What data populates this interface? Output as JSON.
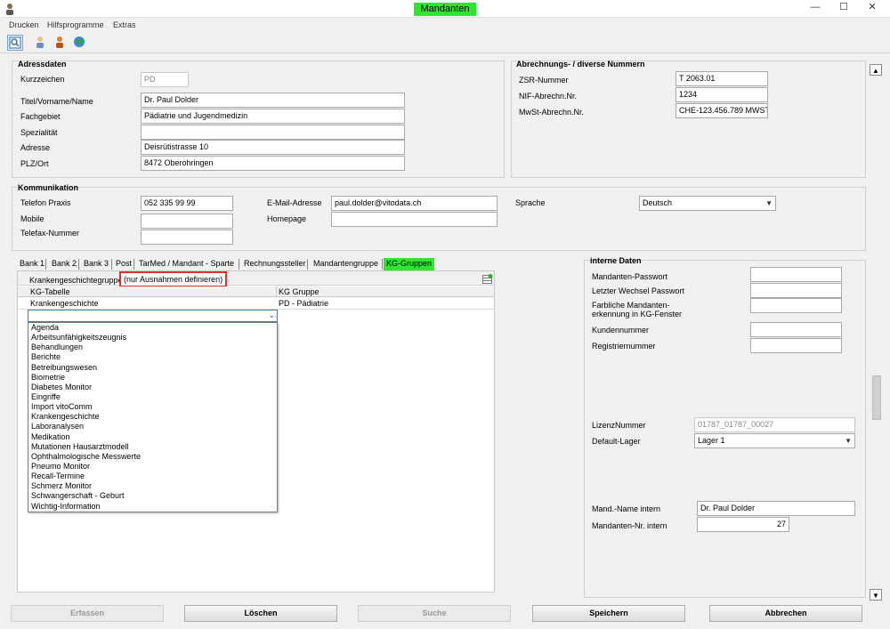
{
  "window": {
    "title": "Mandanten",
    "minimize": "—",
    "maximize": "☐",
    "close": "✕"
  },
  "menu": [
    "Drucken",
    "Hilfsprogramme",
    "Extras"
  ],
  "toolbar_icons": [
    "zoom-icon",
    "user-icon",
    "person-icon",
    "globe-icon"
  ],
  "adressdaten": {
    "title": "Adressdaten",
    "kurzzeichen": {
      "label": "Kurzzeichen",
      "value": "PD"
    },
    "titel": {
      "label": "Titel/Vorname/Name",
      "value": "Dr. Paul Dolder"
    },
    "fachgebiet": {
      "label": "Fachgebiet",
      "value": "Pädiatrie und Jugendmedizin"
    },
    "spezialitaet": {
      "label": "Spezialität",
      "value": ""
    },
    "adresse": {
      "label": "Adresse",
      "value": "Deisrütistrasse 10"
    },
    "plz_ort": {
      "label": "PLZ/Ort",
      "value": "8472 Oberohringen"
    }
  },
  "abrechnung": {
    "title": "Abrechnungs- / diverse Nummern",
    "zsr": {
      "label": "ZSR-Nummer",
      "value": "T 2063.01"
    },
    "nif": {
      "label": "NIF-Abrechn.Nr.",
      "value": "1234"
    },
    "mwst": {
      "label": "MwSt-Abrechn.Nr.",
      "value": "CHE-123.456.789 MWST"
    }
  },
  "kommunikation": {
    "title": "Kommunikation",
    "telefon": {
      "label": "Telefon Praxis",
      "value": "052 335 99 99"
    },
    "mobile": {
      "label": "Mobile",
      "value": ""
    },
    "telefax": {
      "label": "Telefax-Nummer",
      "value": ""
    },
    "email": {
      "label": "E-Mail-Adresse",
      "value": "paul.dolder@vitodata.ch"
    },
    "homepage": {
      "label": "Homepage",
      "value": ""
    },
    "sprache": {
      "label": "Sprache",
      "value": "Deutsch"
    }
  },
  "tabs": [
    "Bank 1",
    "Bank 2",
    "Bank 3",
    "Post",
    "TarMed / Mandant - Sparte",
    "Rechnungssteller",
    "Mandantengruppe",
    "KG-Gruppen"
  ],
  "kg": {
    "header_label": "Krankengeschichtegruppe",
    "header_note": "(nur Ausnahmen definieren)",
    "col1": "KG-Tabelle",
    "col2": "KG Gruppe",
    "row1_col1": "Krankengeschichte",
    "row1_col2": "PD - Pädiatrie",
    "dropdown_value": "",
    "options": [
      "Agenda",
      "Arbeitsunfähigkeitszeugnis",
      "Behandlungen",
      "Berichte",
      "Betreibungswesen",
      "Biometrie",
      "Diabetes Monitor",
      "Eingriffe",
      "Import vitoComm",
      "Krankengeschichte",
      "Laboranalysen",
      "Medikation",
      "Mutationen Hausarztmodell",
      "Ophthalmologische Messwerte",
      "Pneumo Monitor",
      "Recall-Termine",
      "Schmerz Monitor",
      "Schwangerschaft - Geburt",
      "Wichtig-Information"
    ]
  },
  "interne": {
    "title": "interne Daten",
    "passwort": {
      "label": "Mandanten-Passwort",
      "value": ""
    },
    "wechsel": {
      "label": "Letzter Wechsel Passwort",
      "value": ""
    },
    "farbliche_1": "Farbliche Mandanten-",
    "farbliche_2": "erkennung in KG-Fenster",
    "kunden": {
      "label": "Kundennummer",
      "value": ""
    },
    "registrier": {
      "label": "Registriernummer",
      "value": ""
    },
    "lizenz": {
      "label": "LizenzNummer",
      "value": "01787_01787_00027"
    },
    "lager": {
      "label": "Default-Lager",
      "value": "Lager 1"
    },
    "mand_name": {
      "label": "Mand.-Name intern",
      "value": "Dr. Paul Dolder"
    },
    "mand_nr": {
      "label": "Mandanten-Nr. intern",
      "value": "27"
    }
  },
  "buttons": {
    "erfassen": "Erfassen",
    "loeschen": "Löschen",
    "suche": "Suche",
    "speichern": "Speichern",
    "abbrechen": "Abbrechen"
  },
  "colors": {
    "highlight_green": "#2ee62e",
    "highlight_red": "#e0302a"
  }
}
